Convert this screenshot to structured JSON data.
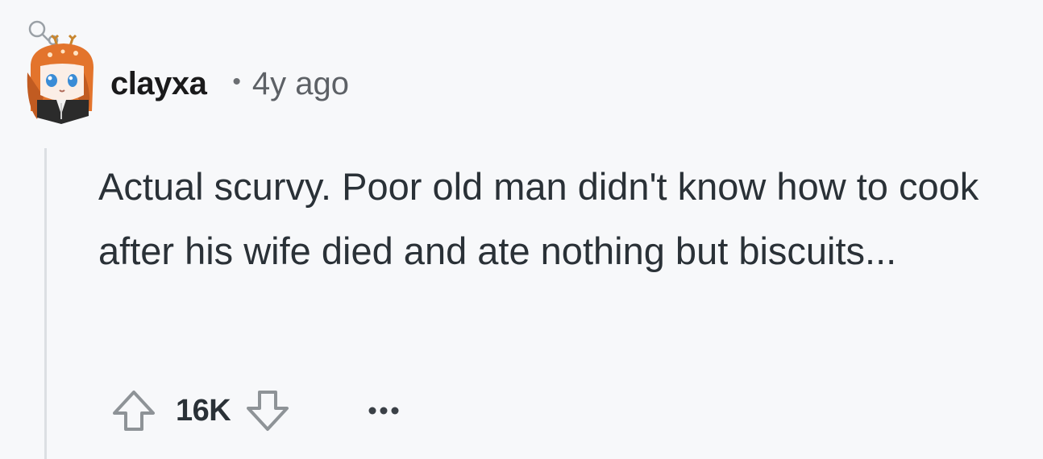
{
  "comment": {
    "author": "clayxa",
    "separator": "•",
    "age": "4y ago",
    "body": "Actual scurvy. Poor old man didn't know how to cook after his wife died and ate nothing but biscuits...",
    "score": "16K"
  },
  "icons": {
    "avatar": "avatar-image",
    "upvote": "upvote-arrow-icon",
    "downvote": "downvote-arrow-icon",
    "more": "more-options-icon"
  },
  "colors": {
    "background": "#f7f8fa",
    "text": "#2a3137",
    "muted": "#5d6166",
    "thread_line": "#dcdfe3",
    "avatar_orange": "#e3742c"
  }
}
